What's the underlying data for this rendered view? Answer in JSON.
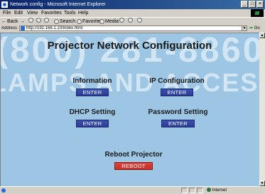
{
  "window": {
    "title": "Network config - Microsoft Internet Explorer",
    "controls": {
      "minimize": "_",
      "maximize": "□",
      "close": "×"
    }
  },
  "menu": {
    "items": [
      "File",
      "Edit",
      "View",
      "Favorites",
      "Tools",
      "Help"
    ]
  },
  "toolbar": {
    "back": "Back",
    "back_icon": "←",
    "forward_icon": "→",
    "search": "Search",
    "favorites": "Favorites",
    "media": "Media"
  },
  "address": {
    "label": "Address",
    "url": "http://192.168.1.10/index.html",
    "go": "Go"
  },
  "watermark": {
    "line1": "(800) 281-8860",
    "line2": "LAMPS AND ACCESSORIES"
  },
  "page": {
    "title": "Projector Network Configuration",
    "sections": {
      "information": {
        "label": "Information",
        "button": "ENTER"
      },
      "ip_configuration": {
        "label": "IP Configuration",
        "button": "ENTER"
      },
      "dhcp_setting": {
        "label": "DHCP Setting",
        "button": "ENTER"
      },
      "password_setting": {
        "label": "Password Setting",
        "button": "ENTER"
      },
      "reboot": {
        "label": "Reboot Projector",
        "button": "REBOOT"
      }
    }
  },
  "status": {
    "zone": "Internet"
  },
  "colors": {
    "page_background": "#9dc6e4",
    "enter_button": "#2f43a0",
    "reboot_button": "#d63a32"
  }
}
